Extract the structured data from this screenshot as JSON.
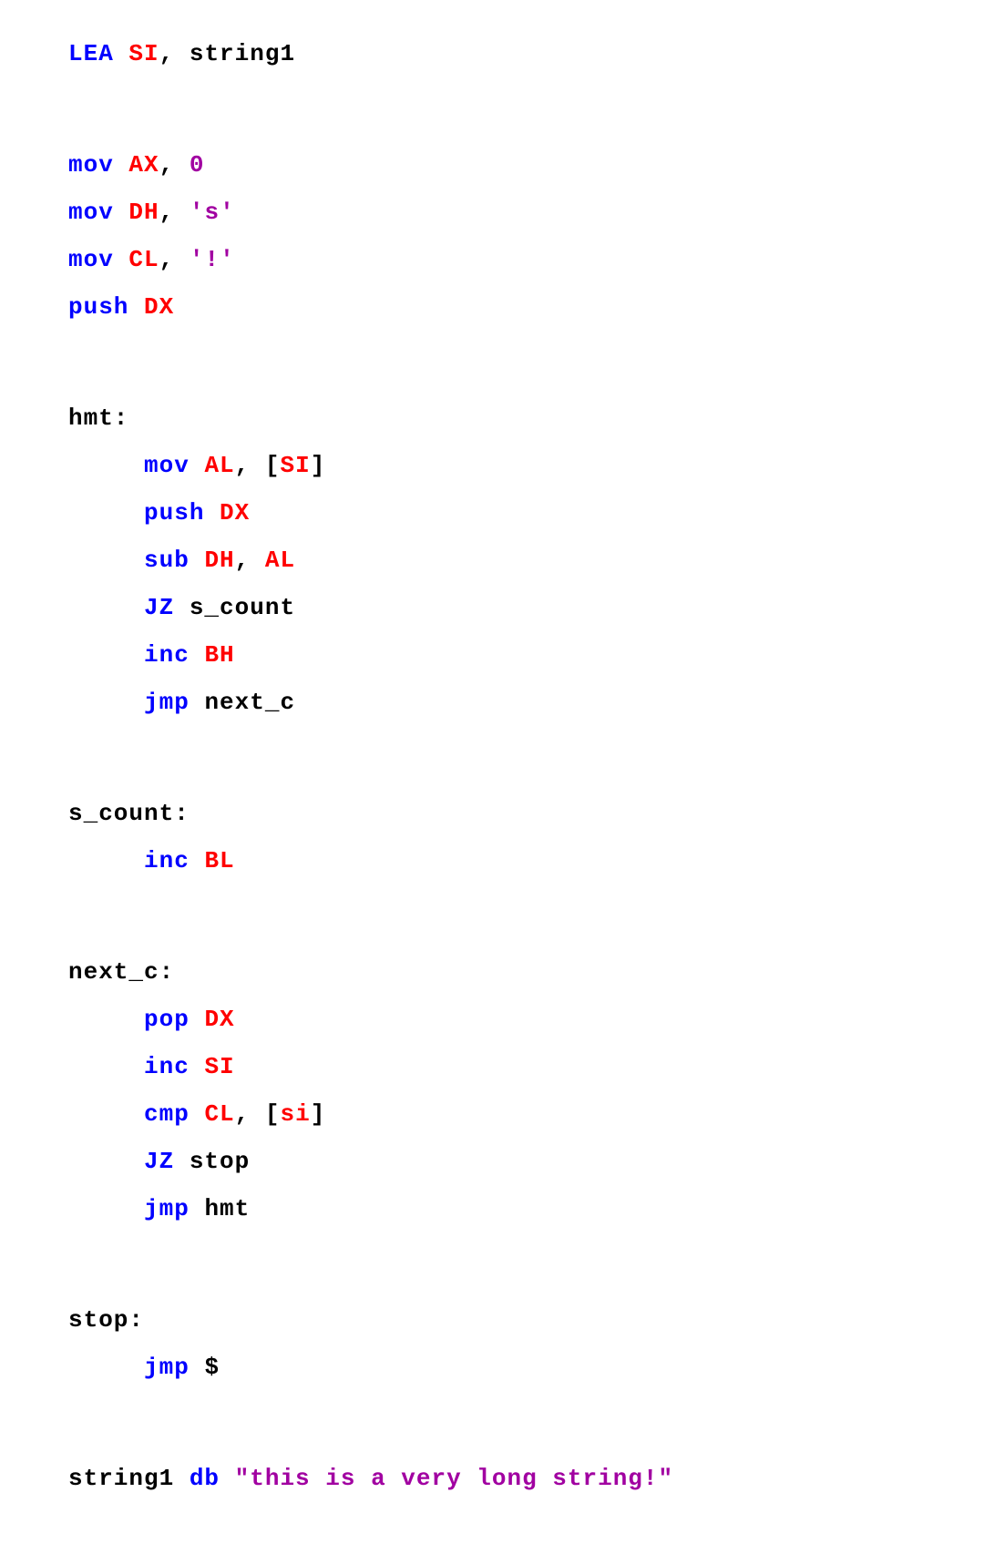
{
  "code": {
    "l1": {
      "a": "LEA ",
      "b": "SI",
      "c": ", string1"
    },
    "l2": {
      "a": "mov ",
      "b": "AX",
      "c": ", ",
      "d": "0"
    },
    "l3": {
      "a": "mov ",
      "b": "DH",
      "c": ", ",
      "d": "'s'"
    },
    "l4": {
      "a": "mov ",
      "b": "CL",
      "c": ", ",
      "d": "'!'"
    },
    "l5": {
      "a": "push ",
      "b": "DX"
    },
    "l6": {
      "a": "hmt:"
    },
    "l7": {
      "pad": "     ",
      "a": "mov ",
      "b": "AL",
      "c": ", [",
      "d": "SI",
      "e": "]"
    },
    "l8": {
      "pad": "     ",
      "a": "push ",
      "b": "DX"
    },
    "l9": {
      "pad": "     ",
      "a": "sub ",
      "b": "DH",
      "c": ", ",
      "d": "AL"
    },
    "l10": {
      "pad": "     ",
      "a": "JZ ",
      "b": "s_count"
    },
    "l11": {
      "pad": "     ",
      "a": "inc ",
      "b": "BH"
    },
    "l12": {
      "pad": "     ",
      "a": "jmp ",
      "b": "next_c"
    },
    "l13": {
      "a": "s_count:"
    },
    "l14": {
      "pad": "     ",
      "a": "inc ",
      "b": "BL"
    },
    "l15": {
      "a": "next_c:"
    },
    "l16": {
      "pad": "     ",
      "a": "pop ",
      "b": "DX"
    },
    "l17": {
      "pad": "     ",
      "a": "inc ",
      "b": "SI"
    },
    "l18": {
      "pad": "     ",
      "a": "cmp ",
      "b": "CL",
      "c": ", [",
      "d": "si",
      "e": "]"
    },
    "l19": {
      "pad": "     ",
      "a": "JZ ",
      "b": "stop"
    },
    "l20": {
      "pad": "     ",
      "a": "jmp ",
      "b": "hmt"
    },
    "l21": {
      "a": "stop:"
    },
    "l22": {
      "pad": "     ",
      "a": "jmp ",
      "b": "$"
    },
    "l23": {
      "a": "string1 ",
      "b": "db ",
      "c": "\"this is a very long string!\""
    }
  }
}
